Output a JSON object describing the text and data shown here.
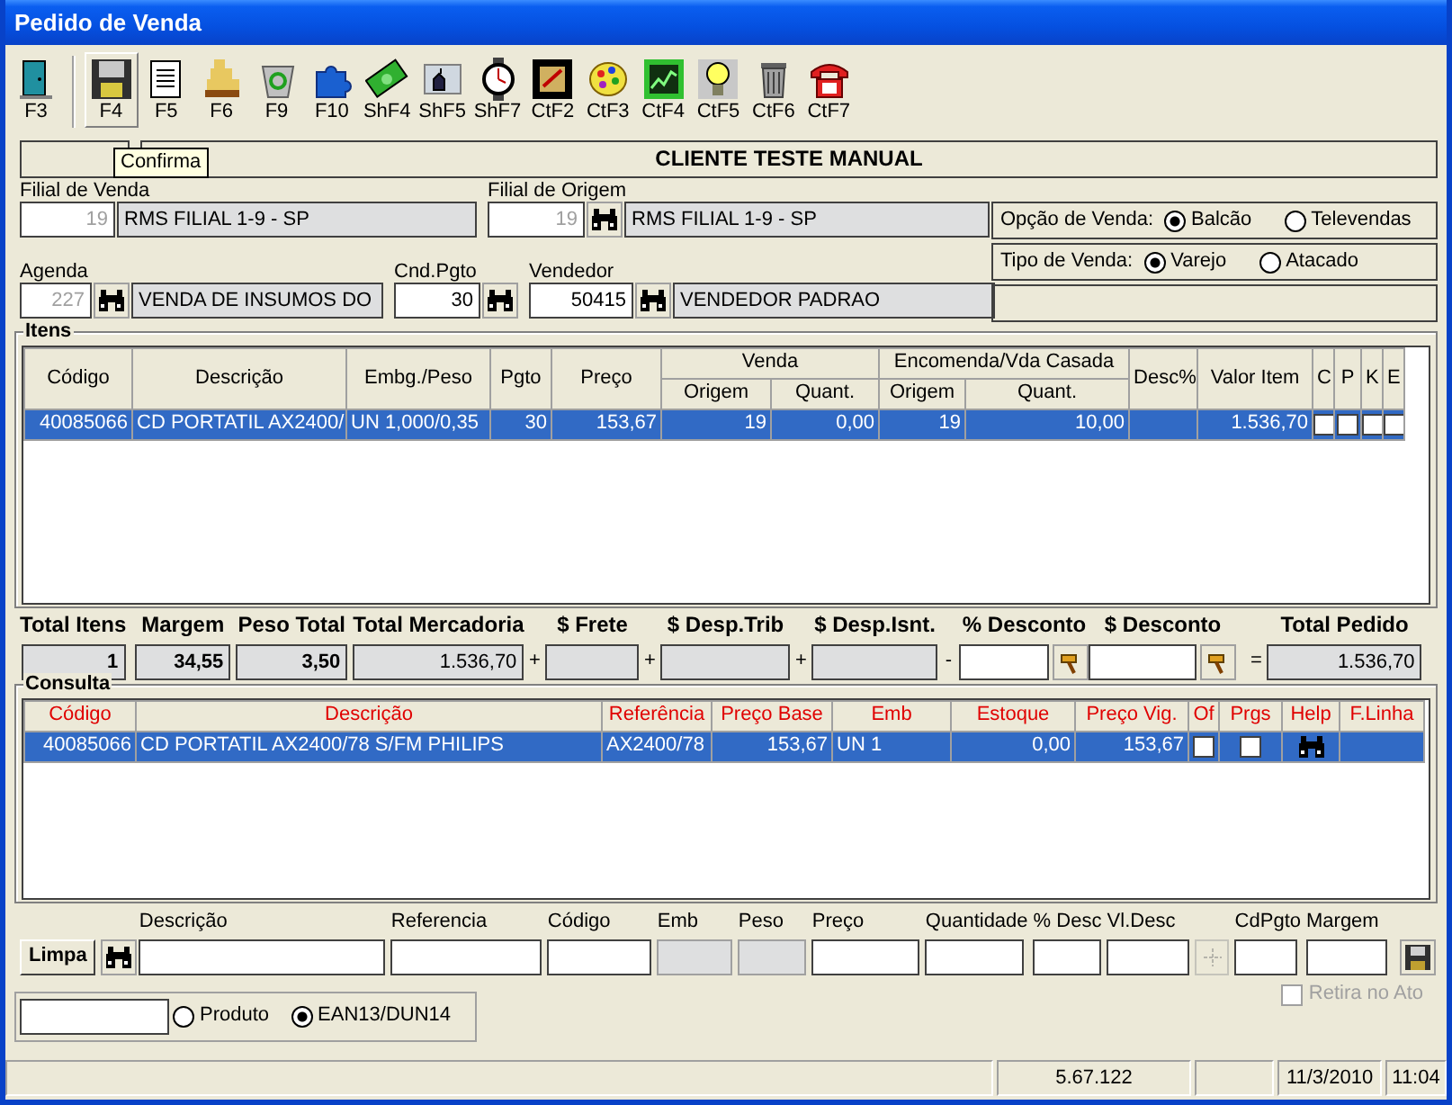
{
  "window": {
    "title": "Pedido de Venda"
  },
  "toolbar": {
    "buttons": [
      {
        "label": "F3",
        "hovered": false
      },
      {
        "label": "F4",
        "hovered": true
      },
      {
        "label": "F5",
        "hovered": false
      },
      {
        "label": "F6",
        "hovered": false
      },
      {
        "label": "F9",
        "hovered": false
      },
      {
        "label": "F10",
        "hovered": false
      },
      {
        "label": "ShF4",
        "hovered": false
      },
      {
        "label": "ShF5",
        "hovered": false
      },
      {
        "label": "ShF7",
        "hovered": false
      },
      {
        "label": "CtF2",
        "hovered": false
      },
      {
        "label": "CtF3",
        "hovered": false
      },
      {
        "label": "CtF4",
        "hovered": false
      },
      {
        "label": "CtF5",
        "hovered": false
      },
      {
        "label": "CtF6",
        "hovered": false
      },
      {
        "label": "CtF7",
        "hovered": false
      }
    ],
    "tooltip": "Confirma"
  },
  "customer": "CLIENTE TESTE MANUAL",
  "filial_venda": {
    "label": "Filial de Venda",
    "code": "19",
    "name": "RMS FILIAL 1-9 - SP"
  },
  "filial_origem": {
    "label": "Filial de Origem",
    "code": "19",
    "name": "RMS FILIAL 1-9 - SP"
  },
  "sale_option": {
    "label": "Opção de Venda:",
    "options": [
      {
        "label": "Balcão",
        "selected": true
      },
      {
        "label": "Televendas",
        "selected": false
      }
    ]
  },
  "agenda": {
    "label": "Agenda",
    "code": "227",
    "name": "VENDA DE INSUMOS DO"
  },
  "payment_condition": {
    "label": "Cnd.Pgto",
    "code": "30"
  },
  "seller": {
    "label": "Vendedor",
    "code": "50415",
    "name": "VENDEDOR PADRAO"
  },
  "sale_type": {
    "label": "Tipo de Venda:",
    "options": [
      {
        "label": "Varejo",
        "selected": true
      },
      {
        "label": "Atacado",
        "selected": false
      }
    ]
  },
  "items": {
    "title": "Itens",
    "columns": [
      {
        "label": "Código"
      },
      {
        "label": "Descrição"
      },
      {
        "label": "Embg./Peso"
      },
      {
        "label": "Pgto"
      },
      {
        "label": "Preço"
      },
      {
        "label": "Venda",
        "colspan": 2,
        "children": [
          {
            "label": "Origem"
          },
          {
            "label": "Quant."
          }
        ]
      },
      {
        "label": "Encomenda/Vda Casada",
        "colspan": 2,
        "children": [
          {
            "label": "Origem"
          },
          {
            "label": "Quant."
          }
        ]
      },
      {
        "label": "Desc%"
      },
      {
        "label": "Valor Item"
      },
      {
        "label": "C"
      },
      {
        "label": "P"
      },
      {
        "label": "K"
      },
      {
        "label": "E"
      }
    ],
    "rows": [
      {
        "cells": [
          "40085066",
          "CD PORTATIL AX2400/",
          "UN 1,000/0,35",
          "30",
          "153,67",
          "19",
          "0,00",
          "19",
          "10,00",
          null,
          "1.536,70"
        ],
        "flags": [
          false,
          false,
          false,
          false
        ],
        "selected": true
      }
    ]
  },
  "totals": [
    {
      "label": "Total Itens",
      "value": "1",
      "bold": true,
      "kind": "readonly"
    },
    {
      "label": "Margem",
      "value": "34,55",
      "bold": true,
      "kind": "readonly"
    },
    {
      "label": "Peso Total",
      "value": "3,50",
      "bold": true,
      "kind": "readonly"
    },
    {
      "label": "Total Mercadoria",
      "value": "1.536,70",
      "bold": false,
      "kind": "readonly"
    },
    {
      "operator": "+",
      "label": "$ Frete",
      "kind": "readonly"
    },
    {
      "operator": "+",
      "label": "$ Desp.Trib",
      "kind": "readonly"
    },
    {
      "operator": "+",
      "label": "$ Desp.Isnt.",
      "kind": "readonly"
    },
    {
      "operator": "-",
      "label": "% Desconto",
      "kind": "input"
    },
    {
      "label": "$ Desconto",
      "kind": "input"
    },
    {
      "operator": "=",
      "label": "Total Pedido",
      "value": "1.536,70",
      "bold": false,
      "kind": "readonly"
    }
  ],
  "consulta": {
    "title": "Consulta",
    "columns": [
      "Código",
      "Descrição",
      "Referência",
      "Preço Base",
      "Emb",
      "Estoque",
      "Preço Vig.",
      "Of",
      "Prgs",
      "Help",
      "F.Linha"
    ],
    "rows": [
      {
        "cells": [
          "40085066",
          "CD PORTATIL AX2400/78 S/FM PHILIPS",
          "AX2400/78",
          "153,67",
          "UN 1",
          "0,00",
          "153,67"
        ],
        "offer": false,
        "progressive": false,
        "selected": true
      }
    ]
  },
  "entry": {
    "clear_button": "Limpa",
    "fields": [
      {
        "kind": "field",
        "label": "Descrição",
        "disabled": false
      },
      {
        "kind": "field",
        "label": "Referencia",
        "disabled": false
      },
      {
        "kind": "field",
        "label": "Código",
        "disabled": false
      },
      {
        "kind": "field",
        "label": "Emb",
        "disabled": true
      },
      {
        "kind": "field",
        "label": "Peso",
        "disabled": true
      },
      {
        "kind": "field",
        "label": "Preço",
        "disabled": false
      },
      {
        "kind": "field",
        "label": "Quantidade",
        "disabled": false
      },
      {
        "kind": "field",
        "label": "% Desc",
        "disabled": false
      },
      {
        "kind": "field",
        "label": "Vl.Desc",
        "disabled": false
      },
      {
        "kind": "picker",
        "disabled": true
      },
      {
        "kind": "field",
        "label": "CdPgto",
        "disabled": false
      },
      {
        "kind": "field",
        "label": "Margem",
        "disabled": false
      }
    ]
  },
  "retira_no_ato": {
    "label": "Retira no Ato",
    "checked": false,
    "disabled": true
  },
  "search_mode": {
    "options": [
      {
        "label": "Produto",
        "selected": false
      },
      {
        "label": "EAN13/DUN14",
        "selected": true
      }
    ]
  },
  "status_bar": [
    "5.67.122",
    "11/3/2010",
    "11:04"
  ]
}
